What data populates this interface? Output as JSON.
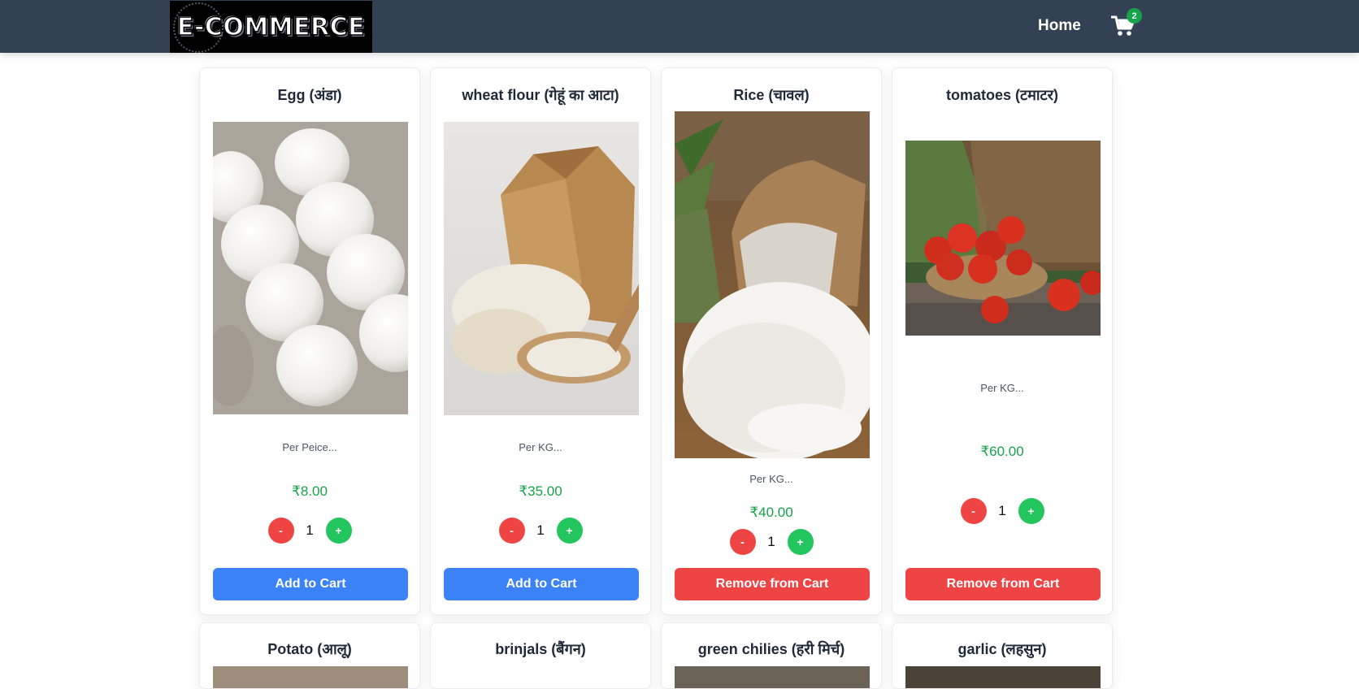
{
  "header": {
    "logo_text": "E-COMMERCE",
    "home_label": "Home",
    "cart_count": "2",
    "cart_icon": "shopping-cart-icon",
    "background_color": "#334155"
  },
  "products": [
    {
      "title": "Egg (अंडा)",
      "description": "Per Peice...",
      "price": "₹8.00",
      "quantity": "1",
      "action_label": "Add to Cart",
      "in_cart": false,
      "image": "eggs-in-carton"
    },
    {
      "title": "wheat flour (गेहूं का आटा)",
      "description": "Per KG...",
      "price": "₹35.00",
      "quantity": "1",
      "action_label": "Add to Cart",
      "in_cart": false,
      "image": "flour-bag-with-spoon"
    },
    {
      "title": "Rice (चावल)",
      "description": "Per KG...",
      "price": "₹40.00",
      "quantity": "1",
      "action_label": "Remove from Cart",
      "in_cart": true,
      "image": "rice-sack"
    },
    {
      "title": "tomatoes (टमाटर)",
      "description": "Per KG...",
      "price": "₹60.00",
      "quantity": "1",
      "action_label": "Remove from Cart",
      "in_cart": true,
      "image": "tomatoes-in-basket"
    },
    {
      "title": "Potato (आलू)"
    },
    {
      "title": "brinjals (बैंगन)"
    },
    {
      "title": "green chilies (हरी मिर्च)"
    },
    {
      "title": "garlic (लहसुन)"
    }
  ],
  "controls": {
    "minus_label": "-",
    "plus_label": "+"
  },
  "colors": {
    "price": "#16a34a",
    "add_button": "#3b82f6",
    "remove_button": "#ef4444",
    "plus_button": "#22c55e",
    "minus_button": "#ef4444"
  }
}
